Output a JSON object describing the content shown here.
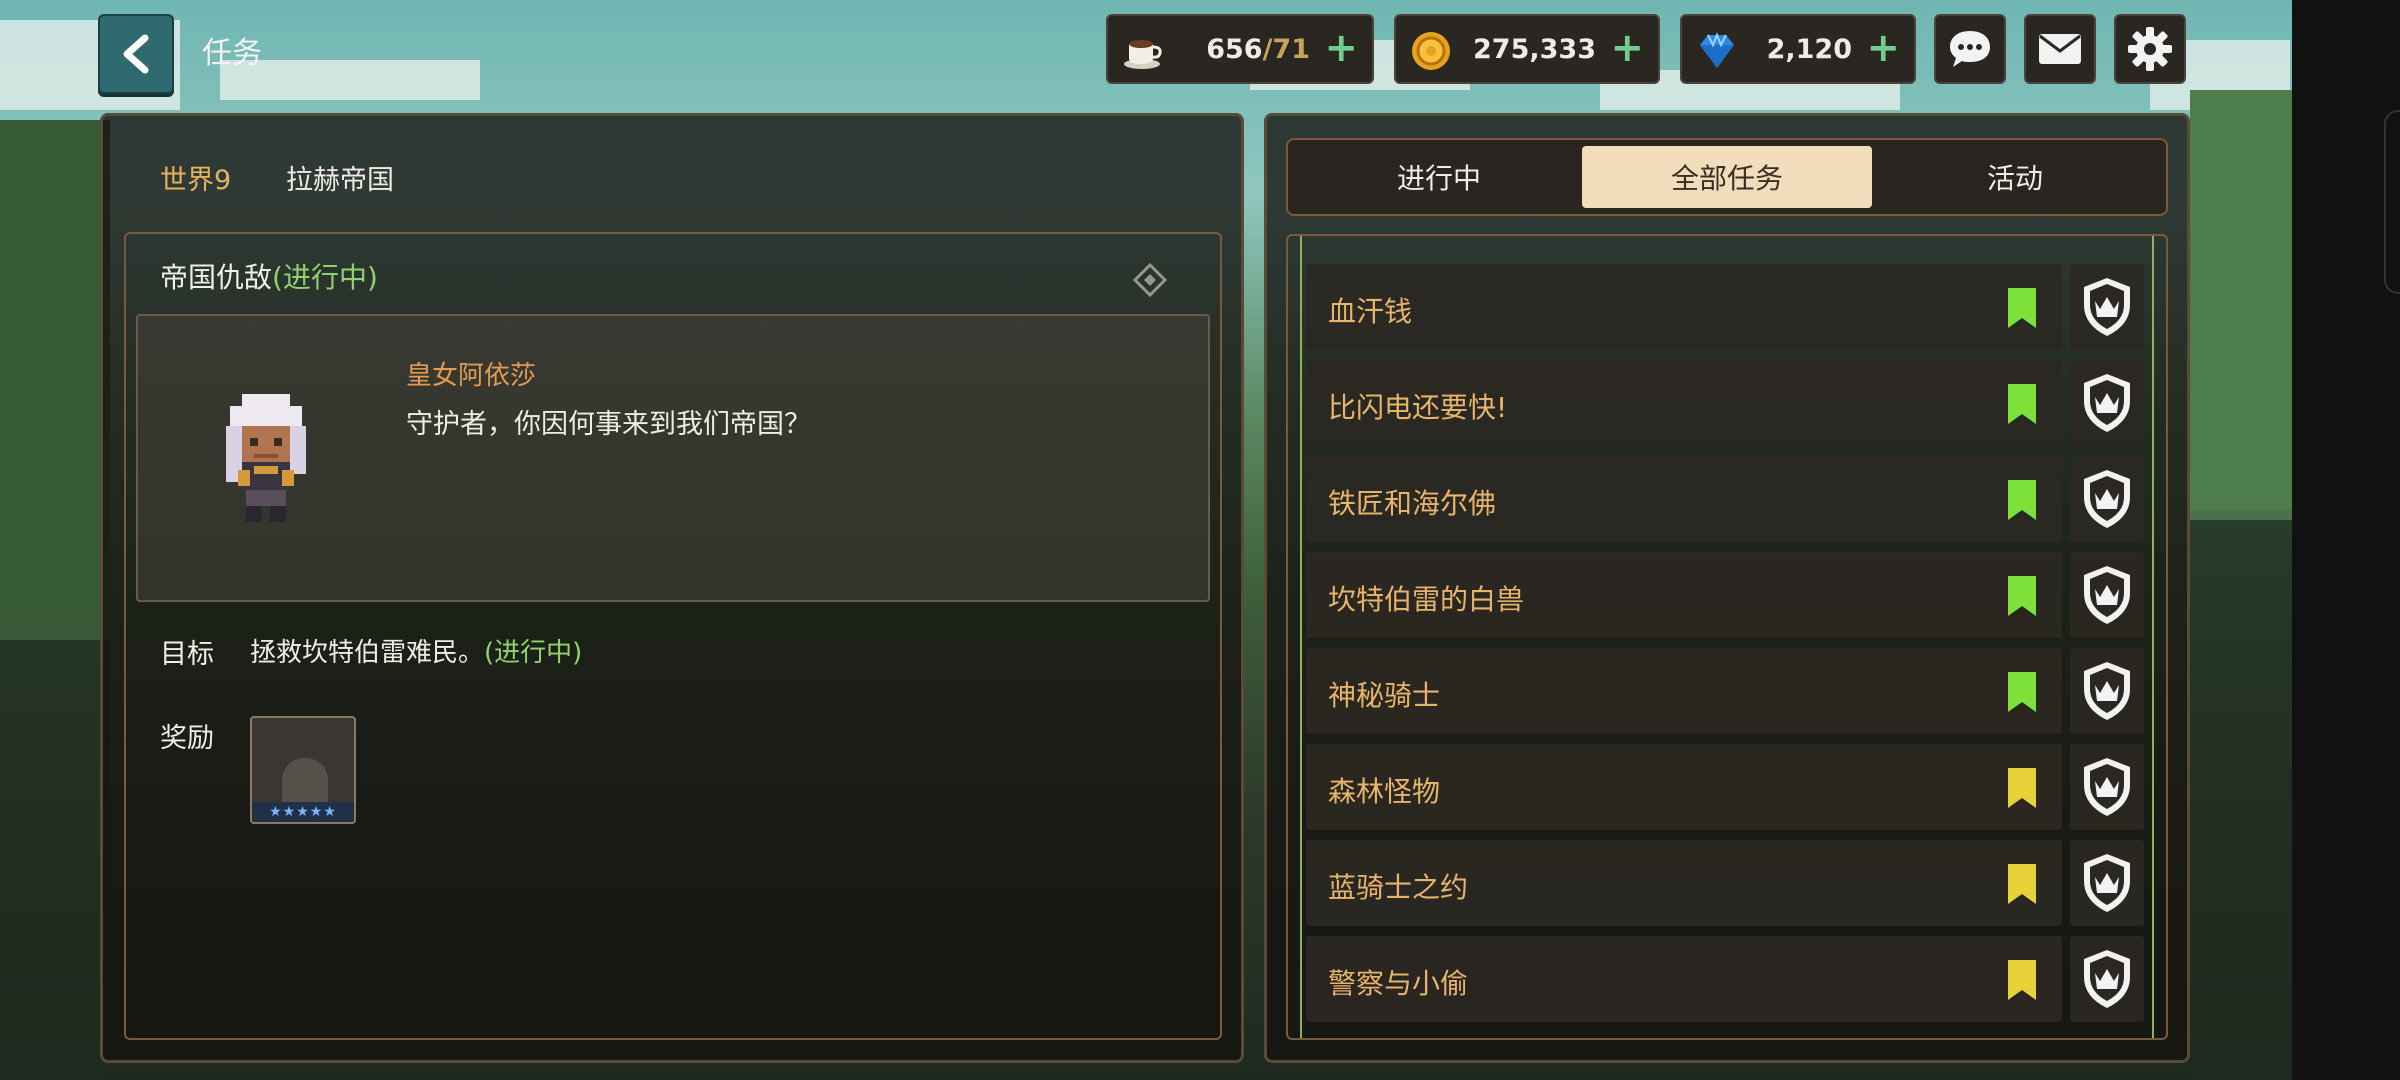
{
  "header": {
    "title": "任务",
    "resources": [
      {
        "icon": "coffee-cup-icon",
        "value": "656",
        "sub": "/71"
      },
      {
        "icon": "gold-coin-icon",
        "value": "275,333",
        "sub": ""
      },
      {
        "icon": "gem-icon",
        "value": "2,120",
        "sub": ""
      }
    ],
    "buttons": [
      "chat-icon",
      "mail-icon",
      "gear-icon"
    ]
  },
  "quest": {
    "world": "世界9",
    "region": "拉赫帝国",
    "title": "帝国仇敌",
    "title_status": "(进行中)",
    "speaker": "皇女阿依莎",
    "dialog": "守护者，你因何事来到我们帝国？",
    "goal_label": "目标",
    "goal_text": "拯救坎特伯雷难民。",
    "goal_status": "(进行中)",
    "reward_label": "奖励"
  },
  "tabs": [
    "进行中",
    "全部任务",
    "活动"
  ],
  "active_tab": 1,
  "quest_list": [
    {
      "name": "血汗钱",
      "flag": "green"
    },
    {
      "name": "比闪电还要快!",
      "flag": "green"
    },
    {
      "name": "铁匠和海尔佛",
      "flag": "green"
    },
    {
      "name": "坎特伯雷的白兽",
      "flag": "green"
    },
    {
      "name": "神秘骑士",
      "flag": "green"
    },
    {
      "name": "森林怪物",
      "flag": "yellow"
    },
    {
      "name": "蓝骑士之约",
      "flag": "yellow"
    },
    {
      "name": "警察与小偷",
      "flag": "yellow"
    }
  ],
  "colors": {
    "flag_green": "#7ee03a",
    "flag_yellow": "#e8d23a",
    "status_green": "#8fd26e",
    "accent_orange": "#e8b36a"
  }
}
